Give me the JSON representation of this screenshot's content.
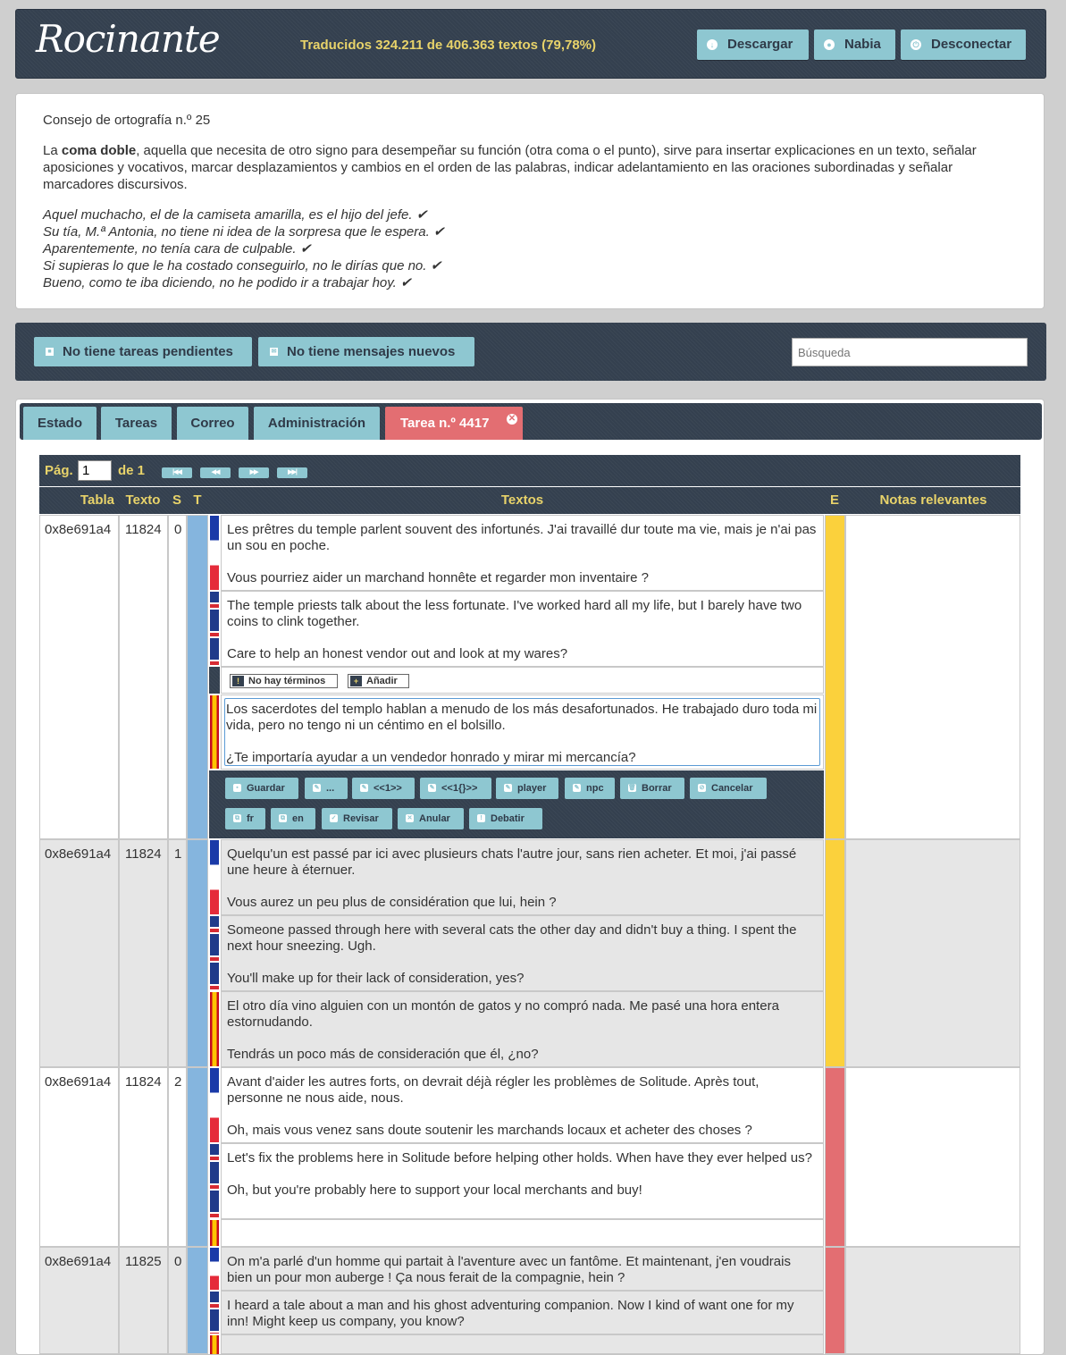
{
  "header": {
    "logo": "Rocinante",
    "progress": "Traducidos 324.211 de 406.363 textos (79,78%)",
    "download": "Descargar",
    "user": "Nabia",
    "logout": "Desconectar"
  },
  "tip": {
    "title": "Consejo de ortografía n.º 25",
    "intro_a": "La ",
    "intro_bold": "coma doble",
    "intro_b": ", aquella que necesita de otro signo para desempeñar su función (otra coma o el punto), sirve para insertar explicaciones en un texto, señalar aposiciones y vocativos, marcar desplazamientos y cambios en el orden de las palabras, indicar adelantamiento en las oraciones subordinadas y señalar marcadores discursivos.",
    "examples": [
      "Aquel muchacho, el de la camiseta amarilla, es el hijo del jefe. ✔",
      "Su tía, M.ª Antonia, no tiene ni idea de la sorpresa que le espera. ✔",
      "Aparentemente, no tenía cara de culpable. ✔",
      "Si supieras lo que le ha costado conseguirlo, no le dirías que no. ✔",
      "Bueno, como te iba diciendo, no he podido ir a trabajar hoy. ✔"
    ]
  },
  "status_bar": {
    "tasks": "No tiene tareas pendientes",
    "messages": "No tiene mensajes nuevos",
    "search_placeholder": "Búsqueda"
  },
  "tabs": [
    "Estado",
    "Tareas",
    "Correo",
    "Administración",
    "Tarea n.º 4417"
  ],
  "pager": {
    "label": "Pág.",
    "page": "1",
    "of": "de 1",
    "buttons": [
      "|◀◀",
      "◀◀",
      "▶▶",
      "▶▶|"
    ]
  },
  "columns": [
    "Tabla",
    "Texto",
    "S",
    "T",
    "Textos",
    "E",
    "Notas relevantes"
  ],
  "rows": [
    {
      "tabla": "0x8e691a4",
      "texto": "11824",
      "s": "0",
      "fr": "Les prêtres du temple parlent souvent des infortunés. J'ai travaillé dur toute ma vie, mais je n'ai pas un sou en poche.\n\nVous pourriez aider un marchand honnête et regarder mon inventaire ?",
      "en": "The temple priests talk about the less fortunate. I've worked hard all my life, but I barely have two coins to clink together.\n\nCare to help an honest vendor out and look at my wares?",
      "es": "Los sacerdotes del templo hablan a menudo de los más desafortunados. He trabajado duro toda mi vida, pero no tengo ni un céntimo en el bolsillo.\n\n¿Te importaría ayudar a un vendedor honrado y mirar mi mercancía?"
    },
    {
      "tabla": "0x8e691a4",
      "texto": "11824",
      "s": "1",
      "fr": "Quelqu'un est passé par ici avec plusieurs chats l'autre jour, sans rien acheter. Et moi, j'ai passé une heure à éternuer.\n\nVous aurez un peu plus de considération que lui, hein ?",
      "en": "Someone passed through here with several cats the other day and didn't buy a thing. I spent the next hour sneezing. Ugh.\n\nYou'll make up for their lack of consideration, yes?",
      "es": "El otro día vino alguien con un montón de gatos y no compró nada. Me pasé una hora entera estornudando.\n\nTendrás un poco más de consideración que él, ¿no?"
    },
    {
      "tabla": "0x8e691a4",
      "texto": "11824",
      "s": "2",
      "fr": "Avant d'aider les autres forts, on devrait déjà régler les problèmes de Solitude. Après tout, personne ne nous aide, nous.\n\nOh, mais vous venez sans doute soutenir les marchands locaux et acheter des choses ?",
      "en": "Let's fix the problems here in Solitude before helping other holds. When have they ever helped us?\n\nOh, but you're probably here to support your local merchants and buy!",
      "es": ""
    },
    {
      "tabla": "0x8e691a4",
      "texto": "11825",
      "s": "0",
      "fr": "On m'a parlé d'un homme qui partait à l'aventure avec un fantôme. Et maintenant, j'en voudrais bien un pour mon auberge ! Ça nous ferait de la compagnie, hein ?",
      "en": "I heard a tale about a man and his ghost adventuring companion. Now I kind of want one for my inn! Might keep us company, you know?",
      "es": ""
    }
  ],
  "terms": {
    "none": "No hay términos",
    "add": "Añadir"
  },
  "editor_buttons": {
    "save": "Guardar",
    "dots": "...",
    "tag1": "<<1>>",
    "tag2": "<<1{}>>",
    "player": "player",
    "npc": "npc",
    "delete": "Borrar",
    "cancel": "Cancelar",
    "fr": "fr",
    "en": "en",
    "review": "Revisar",
    "void": "Anular",
    "debate": "Debatir"
  },
  "colors": {
    "accent": "#8ec7d1",
    "dark": "#34404f",
    "header_text": "#e8d36a",
    "active_tab": "#e36e72",
    "status_yellow": "#fbd13c",
    "status_red": "#e36e72",
    "type_blue": "#85b5de"
  }
}
